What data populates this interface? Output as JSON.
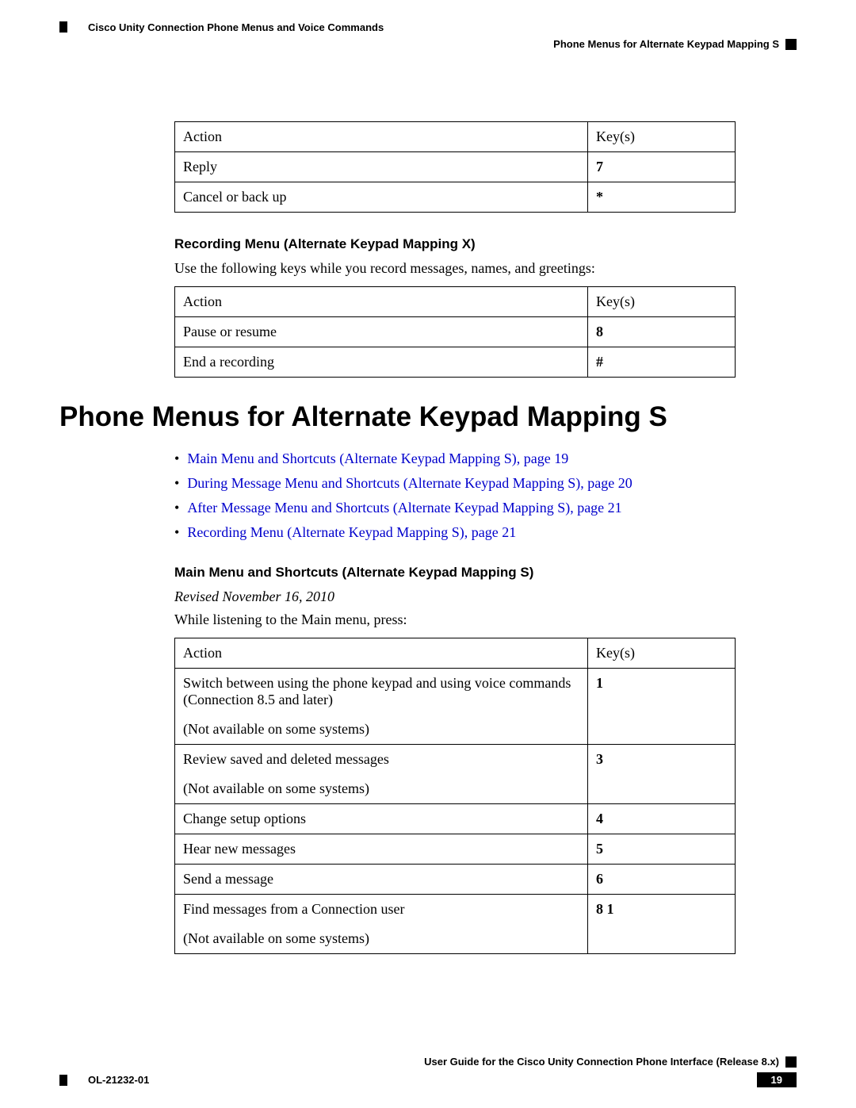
{
  "header": {
    "left": "Cisco Unity Connection Phone Menus and Voice Commands",
    "right": "Phone Menus for Alternate Keypad Mapping S"
  },
  "table1": {
    "headers": {
      "action": "Action",
      "keys": "Key(s)"
    },
    "rows": [
      {
        "action": "Reply",
        "keys": "7"
      },
      {
        "action": "Cancel or back up",
        "keys": "*"
      }
    ]
  },
  "section_recording_x": {
    "title": "Recording Menu (Alternate Keypad Mapping X)",
    "intro": "Use the following keys while you record messages, names, and greetings:"
  },
  "table2": {
    "headers": {
      "action": "Action",
      "keys": "Key(s)"
    },
    "rows": [
      {
        "action": "Pause or resume",
        "keys": "8"
      },
      {
        "action": "End a recording",
        "keys": "#"
      }
    ]
  },
  "main_heading": "Phone Menus for Alternate Keypad Mapping S",
  "toc": [
    "Main Menu and Shortcuts (Alternate Keypad Mapping S),  page 19",
    "During Message Menu and Shortcuts (Alternate Keypad Mapping S),  page 20",
    "After Message Menu and Shortcuts (Alternate Keypad Mapping S),  page 21",
    "Recording Menu (Alternate Keypad Mapping S),  page 21"
  ],
  "section_main_s": {
    "title": "Main Menu and Shortcuts (Alternate Keypad Mapping S)",
    "revised": "Revised November 16, 2010",
    "intro": "While listening to the Main menu, press:"
  },
  "table3": {
    "headers": {
      "action": "Action",
      "keys": "Key(s)"
    },
    "rows": [
      {
        "action": "Switch between using the phone keypad and using voice commands (Connection 8.5 and later)",
        "note": "(Not available on some systems)",
        "keys": "1"
      },
      {
        "action": "Review saved and deleted messages",
        "note": "(Not available on some systems)",
        "keys": "3"
      },
      {
        "action": "Change setup options",
        "keys": "4"
      },
      {
        "action": "Hear new messages",
        "keys": "5"
      },
      {
        "action": "Send a message",
        "keys": "6"
      },
      {
        "action": "Find messages from a Connection user",
        "note": "(Not available on some systems)",
        "keys": "8 1"
      }
    ]
  },
  "footer": {
    "right_title": "User Guide for the Cisco Unity Connection Phone Interface (Release 8.x)",
    "doc_id": "OL-21232-01",
    "page": "19"
  }
}
